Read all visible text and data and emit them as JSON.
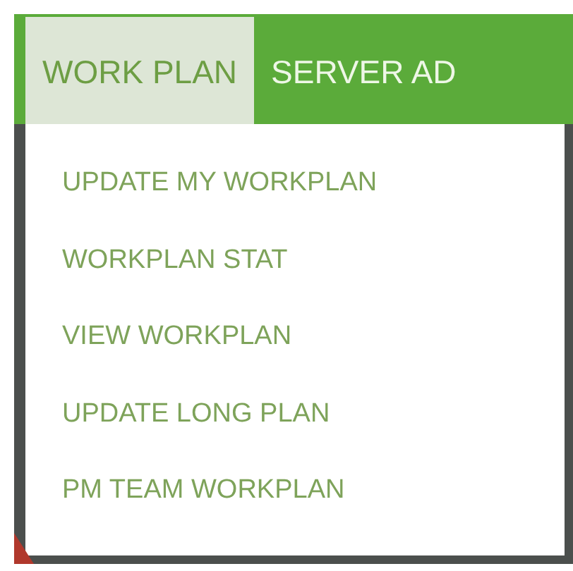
{
  "tabs": [
    {
      "label": "WORK PLAN",
      "selected": true
    },
    {
      "label": "SERVER AD",
      "selected": false
    }
  ],
  "menu": {
    "items": [
      {
        "label": "UPDATE MY WORKPLAN"
      },
      {
        "label": "WORKPLAN STAT"
      },
      {
        "label": "VIEW WORKPLAN"
      },
      {
        "label": "UPDATE LONG PLAN"
      },
      {
        "label": "PM TEAM WORKPLAN"
      }
    ]
  }
}
